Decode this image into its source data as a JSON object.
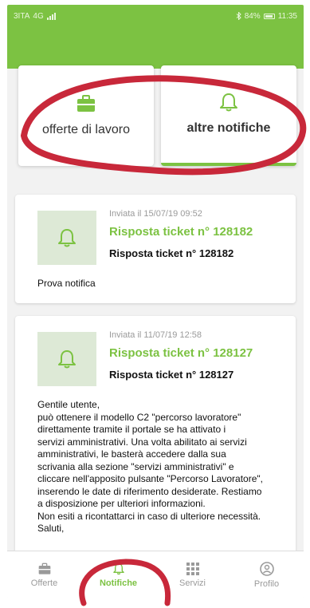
{
  "status_bar": {
    "carrier": "3ITA",
    "signal": "4G",
    "battery_percent": "84%",
    "time": "11:35"
  },
  "categories": [
    {
      "label": "offerte di lavoro",
      "icon": "briefcase-icon",
      "active": false
    },
    {
      "label": "altre notifiche",
      "icon": "bell-icon",
      "active": true
    }
  ],
  "notifications": [
    {
      "sent": "Inviata il 15/07/19 09:52",
      "title": "Risposta ticket n° 128182",
      "subtitle": "Risposta ticket n° 128182",
      "body": "Prova notifica"
    },
    {
      "sent": "Inviata il 11/07/19 12:58",
      "title": "Risposta ticket n° 128127",
      "subtitle": "Risposta ticket n° 128127",
      "body": "Gentile utente,\npuò ottenere il modello C2 \"percorso lavoratore\"\ndirettamente tramite il portale se ha attivato i\nservizi amministrativi. Una volta abilitato ai servizi\namministrativi, le basterà accedere dalla sua\nscrivania alla sezione \"servizi amministrativi\" e\ncliccare nell'apposito pulsante \"Percorso Lavoratore\",\ninserendo le date di riferimento desiderate. Restiamo\na disposizione per ulteriori informazioni.\nNon esiti a ricontattarci in caso di ulteriore necessità.\nSaluti,"
    }
  ],
  "bottom_nav": [
    {
      "label": "Offerte",
      "icon": "briefcase-icon",
      "active": false
    },
    {
      "label": "Notifiche",
      "icon": "bell-icon",
      "active": true
    },
    {
      "label": "Servizi",
      "icon": "grid-icon",
      "active": false
    },
    {
      "label": "Profilo",
      "icon": "user-icon",
      "active": false
    }
  ],
  "colors": {
    "brand_green": "#7cc242",
    "thumb_bg": "#dde9d6",
    "annotation_red": "#c8283a"
  }
}
